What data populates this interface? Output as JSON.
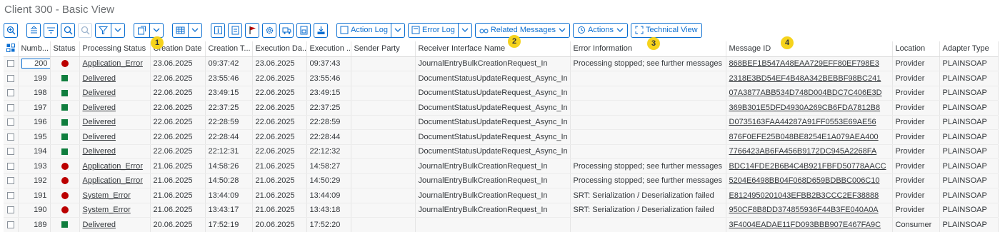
{
  "title": "Client 300 - Basic View",
  "toolbar": {
    "action_log": "Action Log",
    "error_log": "Error Log",
    "related_messages": "Related Messages",
    "actions": "Actions",
    "technical_view": "Technical View"
  },
  "badges": [
    "1",
    "2",
    "3",
    "4"
  ],
  "columns": [
    "Numb...",
    "Status",
    "Processing Status",
    "Creation Date",
    "Creation T...",
    "Execution Da...",
    "Execution ...",
    "Sender Party",
    "Receiver Interface Name",
    "Error Information",
    "Message ID",
    "Location",
    "Adapter Type"
  ],
  "colors": {
    "accent": "#0a6ed1",
    "error": "#bb0000",
    "success": "#107e3e",
    "badge": "#f6d31c"
  },
  "rows": [
    {
      "num": "200",
      "status": "error",
      "proc": "Application_Error",
      "cdate": "23.06.2025",
      "ctime": "09:37:42",
      "edate": "23.06.2025",
      "etime": "09:37:43",
      "sender": "",
      "receiver": "JournalEntryBulkCreationRequest_In",
      "error": "Processing stopped; see further messages",
      "msgid": "868BEF1B547A48EAA729EFF80EF798E3",
      "location": "Provider",
      "adapter": "PLAINSOAP"
    },
    {
      "num": "199",
      "status": "ok",
      "proc": "Delivered",
      "cdate": "22.06.2025",
      "ctime": "23:55:46",
      "edate": "22.06.2025",
      "etime": "23:55:46",
      "sender": "",
      "receiver": "DocumentStatusUpdateRequest_Async_In",
      "error": "",
      "msgid": "2318E3BD54EF4B48A342BEBBF98BC241",
      "location": "Provider",
      "adapter": "PLAINSOAP"
    },
    {
      "num": "198",
      "status": "ok",
      "proc": "Delivered",
      "cdate": "22.06.2025",
      "ctime": "23:49:15",
      "edate": "22.06.2025",
      "etime": "23:49:15",
      "sender": "",
      "receiver": "DocumentStatusUpdateRequest_Async_In",
      "error": "",
      "msgid": "07A3877ABB534D748D004BDC7C406E3D",
      "location": "Provider",
      "adapter": "PLAINSOAP"
    },
    {
      "num": "197",
      "status": "ok",
      "proc": "Delivered",
      "cdate": "22.06.2025",
      "ctime": "22:37:25",
      "edate": "22.06.2025",
      "etime": "22:37:25",
      "sender": "",
      "receiver": "DocumentStatusUpdateRequest_Async_In",
      "error": "",
      "msgid": "369B301E5DFD4930A269CB6FDA7812B8",
      "location": "Provider",
      "adapter": "PLAINSOAP"
    },
    {
      "num": "196",
      "status": "ok",
      "proc": "Delivered",
      "cdate": "22.06.2025",
      "ctime": "22:28:59",
      "edate": "22.06.2025",
      "etime": "22:28:59",
      "sender": "",
      "receiver": "DocumentStatusUpdateRequest_Async_In",
      "error": "",
      "msgid": "D0735163FAA44287A91FF0553E69AE56",
      "location": "Provider",
      "adapter": "PLAINSOAP"
    },
    {
      "num": "195",
      "status": "ok",
      "proc": "Delivered",
      "cdate": "22.06.2025",
      "ctime": "22:28:44",
      "edate": "22.06.2025",
      "etime": "22:28:44",
      "sender": "",
      "receiver": "DocumentStatusUpdateRequest_Async_In",
      "error": "",
      "msgid": "876F0EFE25B048BE8254E1A079AEA400",
      "location": "Provider",
      "adapter": "PLAINSOAP"
    },
    {
      "num": "194",
      "status": "ok",
      "proc": "Delivered",
      "cdate": "22.06.2025",
      "ctime": "22:12:31",
      "edate": "22.06.2025",
      "etime": "22:12:32",
      "sender": "",
      "receiver": "DocumentStatusUpdateRequest_Async_In",
      "error": "",
      "msgid": "7766423AB6FA456B9172DC945A2268FA",
      "location": "Provider",
      "adapter": "PLAINSOAP"
    },
    {
      "num": "193",
      "status": "error",
      "proc": "Application_Error",
      "cdate": "21.06.2025",
      "ctime": "14:58:26",
      "edate": "21.06.2025",
      "etime": "14:58:27",
      "sender": "",
      "receiver": "JournalEntryBulkCreationRequest_In",
      "error": "Processing stopped; see further messages",
      "msgid": "BDC14FDE2B6B4C4B921FBFD50778AACC",
      "location": "Provider",
      "adapter": "PLAINSOAP"
    },
    {
      "num": "192",
      "status": "error",
      "proc": "Application_Error",
      "cdate": "21.06.2025",
      "ctime": "14:50:28",
      "edate": "21.06.2025",
      "etime": "14:50:29",
      "sender": "",
      "receiver": "JournalEntryBulkCreationRequest_In",
      "error": "Processing stopped; see further messages",
      "msgid": "5204E6498BB04F068D659BDBBC006C10",
      "location": "Provider",
      "adapter": "PLAINSOAP"
    },
    {
      "num": "191",
      "status": "error",
      "proc": "System_Error",
      "cdate": "21.06.2025",
      "ctime": "13:44:09",
      "edate": "21.06.2025",
      "etime": "13:44:09",
      "sender": "",
      "receiver": "JournalEntryBulkCreationRequest_In",
      "error": "SRT: Serialization / Deserialization failed",
      "msgid": "E8124950201043EFBB2B3CCC2EF38888",
      "location": "Provider",
      "adapter": "PLAINSOAP"
    },
    {
      "num": "190",
      "status": "error",
      "proc": "System_Error",
      "cdate": "21.06.2025",
      "ctime": "13:43:17",
      "edate": "21.06.2025",
      "etime": "13:43:18",
      "sender": "",
      "receiver": "JournalEntryBulkCreationRequest_In",
      "error": "SRT: Serialization / Deserialization failed",
      "msgid": "950CF8B8DD374855936F44B3FE040A0A",
      "location": "Provider",
      "adapter": "PLAINSOAP"
    },
    {
      "num": "189",
      "status": "ok",
      "proc": "Delivered",
      "cdate": "20.06.2025",
      "ctime": "17:52:19",
      "edate": "20.06.2025",
      "etime": "17:52:20",
      "sender": "",
      "receiver": "",
      "error": "",
      "msgid": "3F4004EADAE11FD093BBB907E467FA9C",
      "location": "Consumer",
      "adapter": "PLAINSOAP"
    }
  ]
}
